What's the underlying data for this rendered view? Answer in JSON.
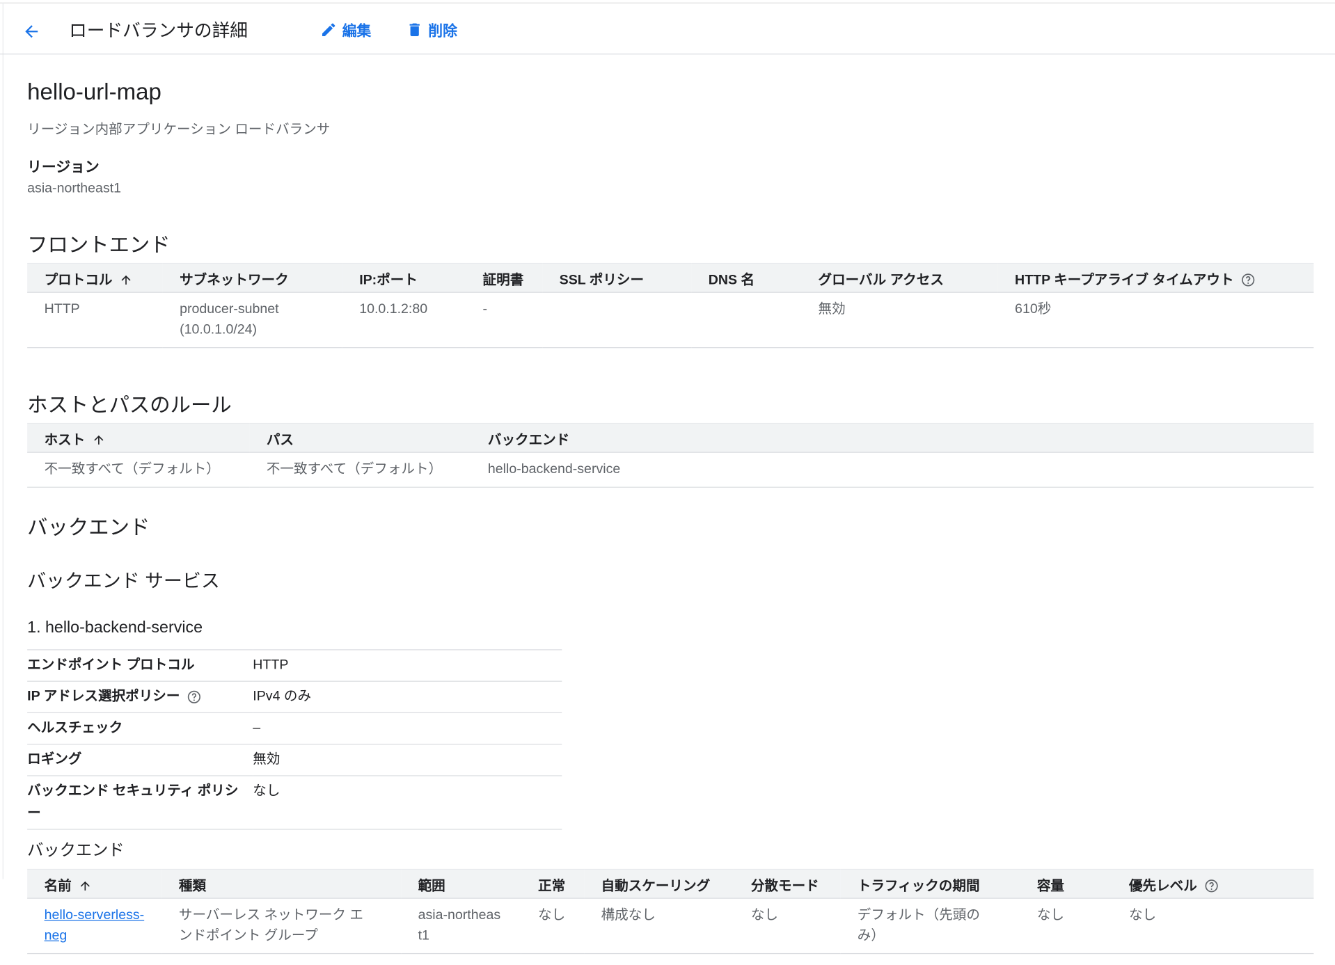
{
  "toolbar": {
    "title": "ロードバランサの詳細",
    "edit_label": "編集",
    "delete_label": "削除",
    "back_icon": "arrow-left-icon",
    "edit_icon": "pencil-icon",
    "delete_icon": "trash-icon",
    "accent_color": "#1a73e8"
  },
  "lb": {
    "name": "hello-url-map",
    "type": "リージョン内部アプリケーション ロードバランサ",
    "region_label": "リージョン",
    "region_value": "asia-northeast1"
  },
  "frontend": {
    "title": "フロントエンド",
    "columns": [
      "プロトコル",
      "サブネットワーク",
      "IP:ポート",
      "証明書",
      "SSL ポリシー",
      "DNS 名",
      "グローバル アクセス",
      "HTTP キープアライブ タイムアウト"
    ],
    "rows": [
      [
        "HTTP",
        "producer-subnet (10.0.1.0/24)",
        "10.0.1.2:80",
        "-",
        "",
        "",
        "無効",
        "610秒"
      ]
    ]
  },
  "host_rules": {
    "title": "ホストとパスのルール",
    "columns": [
      "ホスト",
      "パス",
      "バックエンド"
    ],
    "rows": [
      [
        "不一致すべて（デフォルト）",
        "不一致すべて（デフォルト）",
        "hello-backend-service"
      ]
    ]
  },
  "backends": {
    "title": "バックエンド",
    "services_title": "バックエンド サービス",
    "service_name": "1. hello-backend-service",
    "properties": [
      {
        "key": "エンドポイント プロトコル",
        "value": "HTTP"
      },
      {
        "key": "IP アドレス選択ポリシー",
        "value": "IPv4 のみ"
      },
      {
        "key": "ヘルスチェック",
        "value": "–"
      },
      {
        "key": "ロギング",
        "value": "無効"
      },
      {
        "key": "バックエンド セキュリティ ポリシー",
        "value": "なし"
      }
    ],
    "table_title": "バックエンド",
    "columns": [
      "名前",
      "種類",
      "範囲",
      "正常",
      "自動スケーリング",
      "分散モード",
      "トラフィックの期間",
      "容量",
      "優先レベル"
    ],
    "rows": [
      [
        "hello-serverless-neg",
        "サーバーレス ネットワーク エンドポイント グループ",
        "asia-northeast1",
        "なし",
        "構成なし",
        "なし",
        "デフォルト（先頭のみ）",
        "なし",
        "なし"
      ]
    ]
  }
}
